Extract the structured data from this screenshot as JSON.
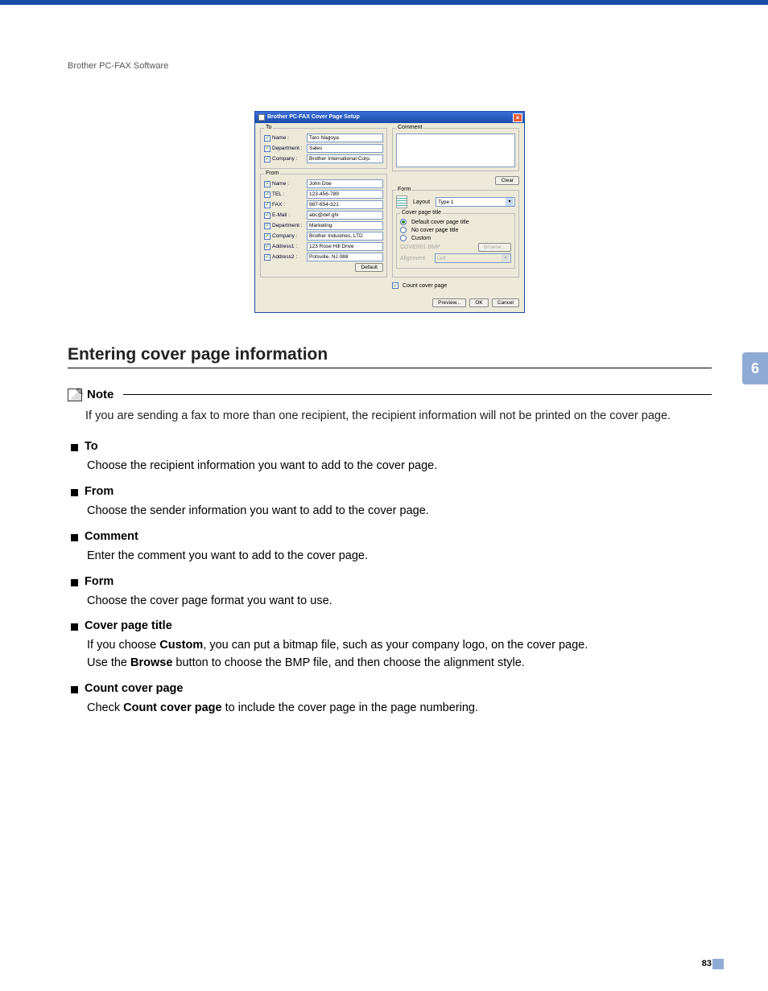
{
  "header": "Brother PC-FAX Software",
  "sideTab": "6",
  "pageNumber": "83",
  "dialog": {
    "title": "Brother PC-FAX Cover Page Setup",
    "to": {
      "legend": "To",
      "name": {
        "label": "Name :",
        "value": "Taro Nagoya"
      },
      "department": {
        "label": "Department :",
        "value": "Sales"
      },
      "company": {
        "label": "Company :",
        "value": "Brother International Corp."
      }
    },
    "from": {
      "legend": "From",
      "name": {
        "label": "Name :",
        "value": "John Doe"
      },
      "tel": {
        "label": "TEL :",
        "value": "123-456-789"
      },
      "fax": {
        "label": "FAX :",
        "value": "987-654-321"
      },
      "email": {
        "label": "E-Mail :",
        "value": "abc@def.ghi"
      },
      "department": {
        "label": "Department :",
        "value": "Marketing"
      },
      "company": {
        "label": "Company :",
        "value": "Brother Industries, LTD"
      },
      "address1": {
        "label": "Address1 :",
        "value": "123 Rose Hill Drive"
      },
      "address2": {
        "label": "Address2 :",
        "value": "Potsville, NJ 088"
      }
    },
    "defaultBtn": "Default",
    "comment": {
      "legend": "Comment"
    },
    "clearBtn": "Clear",
    "form": {
      "legend": "Form",
      "layoutLabel": "Layout",
      "layoutValue": "Type 1",
      "coverTitleLegend": "Cover page title",
      "optDefault": "Default cover page title",
      "optNone": "No cover page title",
      "optCustom": "Custom",
      "customFile": "COVER01.BMP",
      "browseBtn": "Browse...",
      "alignLabel": "Alignment",
      "alignValue": "Left"
    },
    "countCover": "Count cover page",
    "previewBtn": "Preview...",
    "okBtn": "OK",
    "cancelBtn": "Cancel"
  },
  "section": {
    "heading": "Entering cover page information",
    "noteLabel": "Note",
    "noteText": "If you are sending a fax to more than one recipient, the recipient information will not be printed on the cover page.",
    "items": [
      {
        "title": "To",
        "body": "Choose the recipient information you want to add to the cover page."
      },
      {
        "title": "From",
        "body": "Choose the sender information you want to add to the cover page."
      },
      {
        "title": "Comment",
        "body": "Enter the comment you want to add to the cover page."
      },
      {
        "title": "Form",
        "body": "Choose the cover page format you want to use."
      }
    ],
    "coverPageTitle": {
      "title": "Cover page title",
      "line1a": "If you choose ",
      "line1b": "Custom",
      "line1c": ", you can put a bitmap file, such as your company logo, on the cover page.",
      "line2a": "Use the ",
      "line2b": "Browse",
      "line2c": " button to choose the BMP file, and then choose the alignment style."
    },
    "countCoverPage": {
      "title": "Count cover page",
      "a": "Check ",
      "b": "Count cover page",
      "c": " to include the cover page in the page numbering."
    }
  }
}
